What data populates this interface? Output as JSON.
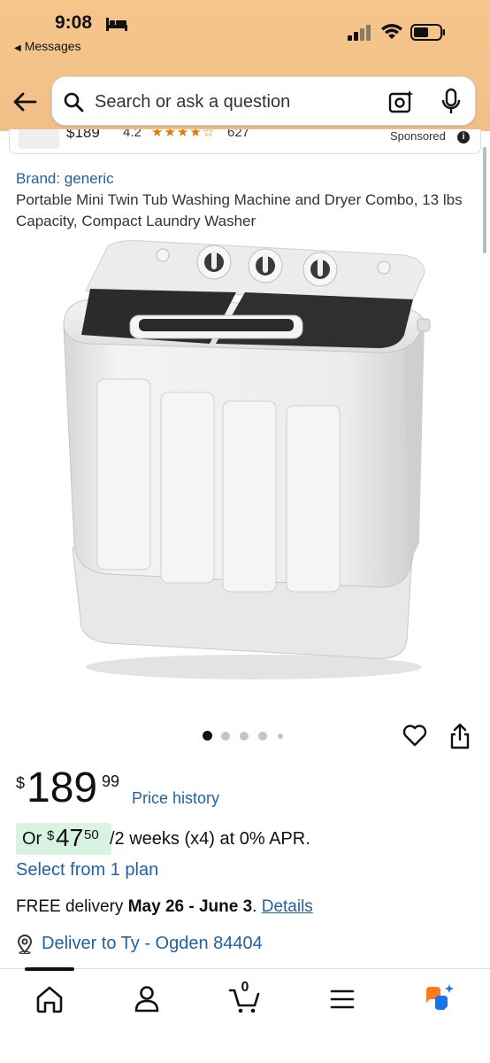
{
  "status_bar": {
    "time": "9:08",
    "back_app": "Messages"
  },
  "search": {
    "placeholder": "Search or ask a question"
  },
  "sponsored_item": {
    "price": "$189",
    "rating": "4.2",
    "review_count": "627",
    "label": "Sponsored",
    "info_icon": "info-icon"
  },
  "product": {
    "brand": "Brand: generic",
    "title": "Portable Mini Twin Tub Washing Machine and Dryer Combo, 13 lbs Capacity, Compact Laundry Washer",
    "image_count": 5,
    "active_image_index": 0
  },
  "price": {
    "currency": "$",
    "whole": "189",
    "fraction": "99",
    "history_link": "Price history"
  },
  "installment": {
    "prefix": "Or",
    "currency": "$",
    "whole": "47",
    "fraction": "50",
    "terms": "/2 weeks (x4) at 0% APR."
  },
  "plan_link": "Select from 1 plan",
  "delivery": {
    "prefix": "FREE delivery ",
    "dates": "May 26 - June 3",
    "separator": ". ",
    "details_link": "Details"
  },
  "deliver_to": "Deliver to Ty - Ogden 84404",
  "bottom_nav": {
    "items": [
      "home-icon",
      "account-icon",
      "cart-icon",
      "menu-icon",
      "rufus-icon"
    ],
    "cart_count": "0",
    "active_index": 0
  },
  "colors": {
    "header_bg": "#f5c58c",
    "link": "#2162a1",
    "installment_bg": "#d8f3e1",
    "star": "#e77600"
  }
}
